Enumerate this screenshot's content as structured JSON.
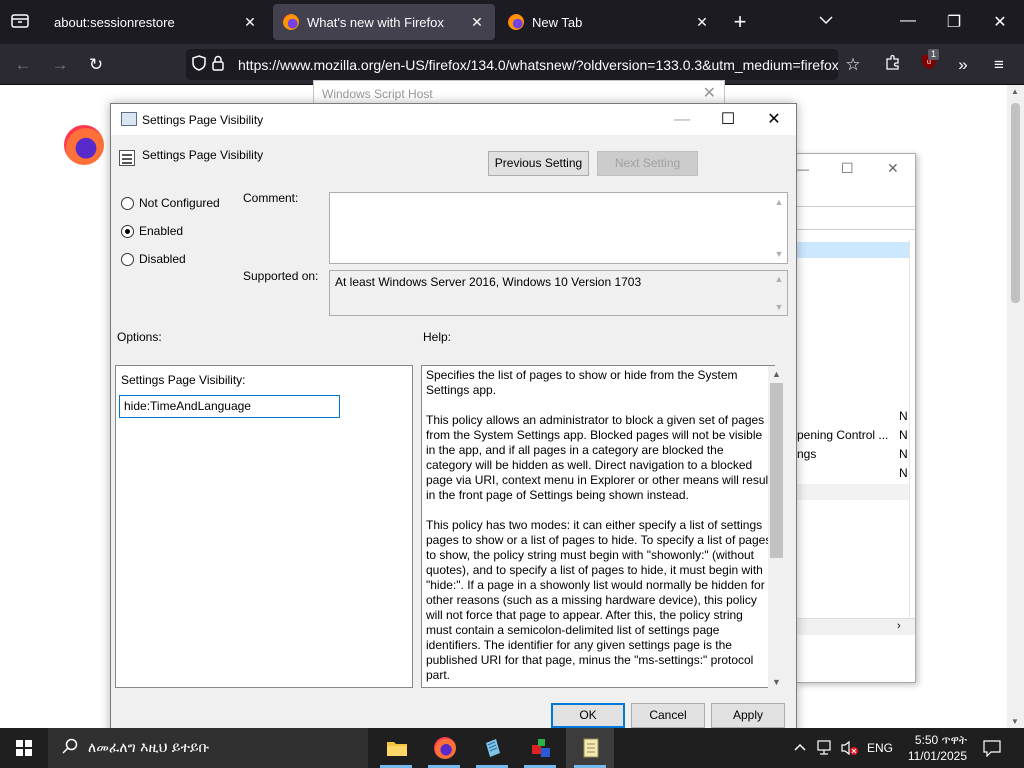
{
  "browser": {
    "tabs": [
      {
        "title": "about:sessionrestore",
        "active": false
      },
      {
        "title": "What's new with Firefox",
        "active": true
      },
      {
        "title": "New Tab",
        "active": false
      }
    ],
    "new_tab_glyph": "+",
    "url": "https://www.mozilla.org/en-US/firefox/134.0/whatsnew/?oldversion=133.0.3&utm_medium=firefox",
    "extension_badge": "1"
  },
  "wsh_window": {
    "title": "Windows Script Host"
  },
  "gp_editor_partial": {
    "rows": [
      "pening Control ...",
      "ngs"
    ],
    "state_letter": "N"
  },
  "dialog": {
    "title": "Settings Page Visibility",
    "header_title": "Settings Page Visibility",
    "prev_button": "Previous Setting",
    "next_button": "Next Setting",
    "radios": [
      {
        "label": "Not Configured",
        "selected": false
      },
      {
        "label": "Enabled",
        "selected": true
      },
      {
        "label": "Disabled",
        "selected": false
      }
    ],
    "comment_label": "Comment:",
    "comment_value": "",
    "supported_label": "Supported on:",
    "supported_value": "At least Windows Server 2016, Windows 10 Version 1703",
    "options_label": "Options:",
    "help_label": "Help:",
    "option_field_label": "Settings Page Visibility:",
    "option_field_value": "hide:TimeAndLanguage",
    "help_paragraphs": [
      "Specifies the list of pages to show or hide from the System Settings app.",
      "This policy allows an administrator to block a given set of pages from the System Settings app. Blocked pages will not be visible in the app, and if all pages in a category are blocked the category will be hidden as well. Direct navigation to a blocked page via URI, context menu in Explorer or other means will result in the front page of Settings being shown instead.",
      "This policy has two modes: it can either specify a list of settings pages to show or a list of pages to hide. To specify a list of pages to show, the policy string must begin with \"showonly:\" (without quotes), and to specify a list of pages to hide, it must begin with \"hide:\". If a page in a showonly list would normally be hidden for other reasons (such as a missing hardware device), this policy will not force that page to appear. After this, the policy string must contain a semicolon-delimited list of settings page identifiers. The identifier for any given settings page is the published URI for that page, minus the \"ms-settings:\" protocol part."
    ],
    "ok_button": "OK",
    "cancel_button": "Cancel",
    "apply_button": "Apply"
  },
  "taskbar": {
    "search_text": "ለመፈለግ እዚህ ይተይቡ",
    "language": "ENG",
    "time": "5:50 ጥዋት",
    "date": "11/01/2025"
  }
}
